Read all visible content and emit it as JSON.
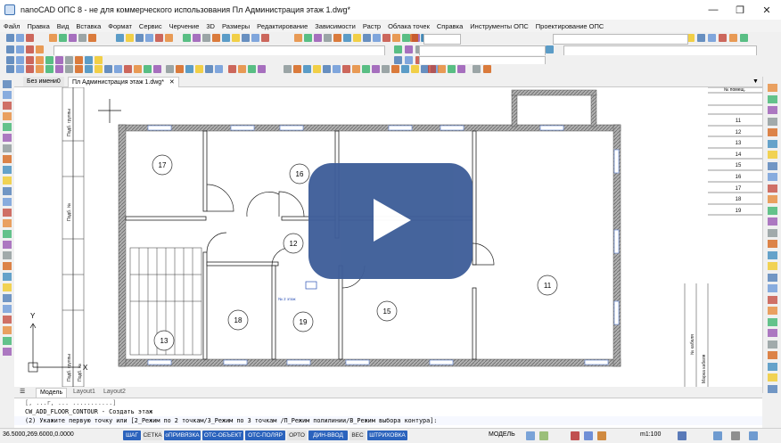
{
  "window": {
    "title": "nanoCAD ОПС 8 - не для коммерческого использования Пл Администрация этаж 1.dwg*",
    "minimize_glyph": "—",
    "maximize_glyph": "❐",
    "close_glyph": "✕"
  },
  "menu": [
    "Файл",
    "Правка",
    "Вид",
    "Вставка",
    "Формат",
    "Сервис",
    "Черчение",
    "3D",
    "Размеры",
    "Редактирование",
    "Зависимости",
    "Растр",
    "Облака точек",
    "Справка",
    "Инструменты ОПС",
    "Проектирование ОПС"
  ],
  "document_tabs": [
    {
      "label": "Без имени0",
      "active": false
    },
    {
      "label": "Пл Администрация этаж 1.dwg*",
      "active": true,
      "close": "✕"
    }
  ],
  "doc_menu_arrow": "▼",
  "drawing": {
    "rooms": [
      {
        "number": "17"
      },
      {
        "number": "16"
      },
      {
        "number": "12"
      },
      {
        "number": "18"
      },
      {
        "number": "19"
      },
      {
        "number": "15"
      },
      {
        "number": "13"
      },
      {
        "number": "11"
      }
    ],
    "area_label": "№ 2 этаж",
    "axis_y_label": "Y",
    "axis_x_label": "X",
    "left_table": [
      "Подб. группы",
      "Подб. №",
      "Подб. группы",
      "Подб. №"
    ],
    "right_table": {
      "header": "№ помещ.",
      "rows": [
        "11",
        "12",
        "13",
        "14",
        "15",
        "16",
        "17",
        "18",
        "19"
      ],
      "vertical": [
        "№ кабеля",
        "Марка кабеля"
      ]
    }
  },
  "layout_tabs": [
    {
      "label": "Модель",
      "active": true
    },
    {
      "label": "Layout1",
      "active": false
    },
    {
      "label": "Layout2",
      "active": false
    }
  ],
  "command_lines": [
    "[, ...r, ... ...........]",
    "CW_ADD_FLOOR_CONTOUR - Создать этаж",
    "(2) Укажите первую точку или [2_Режим по 2 точкам/3_Режим по 3 точкам /П_Режим полилинии/В_Режим выбора контура]:"
  ],
  "status": {
    "coords": "36.5000,269.6000,0.0000",
    "toggles": [
      {
        "label": "ШАГ",
        "on": true
      },
      {
        "label": "СЕТКА",
        "on": false
      },
      {
        "label": "оПРИВЯЗКА",
        "on": true
      },
      {
        "label": "ОТС-ОБЪЕКТ",
        "on": true
      },
      {
        "label": "ОТС-ПОЛЯР",
        "on": true
      },
      {
        "label": "ОРТО",
        "on": false
      },
      {
        "label": "ДИН-ВВОД",
        "on": true
      },
      {
        "label": "ВЕС",
        "on": false
      },
      {
        "label": "ШТРИХОВКА",
        "on": true
      }
    ],
    "model_label": "МОДЕЛЬ",
    "scale": "m1:100"
  },
  "colors": {
    "accent": "#2b63bd",
    "play_button": "#3e5e99",
    "wall_hatch": "#8a8a8a"
  }
}
